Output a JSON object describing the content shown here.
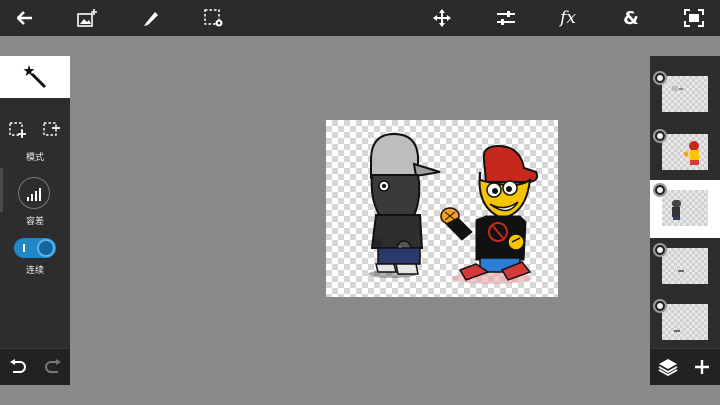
{
  "toolbar": {
    "icons": [
      "back-arrow-icon",
      "add-image-icon",
      "brush-icon",
      "selection-settings-icon",
      "move-icon",
      "adjustments-icon",
      "fx-icon",
      "ampersand-icon",
      "fit-screen-icon"
    ],
    "fx_label": "fx",
    "amp_label": "&"
  },
  "tools": {
    "active_tool": "magic-wand-icon",
    "mode_label": "模式",
    "tolerance_label": "容差",
    "contiguous_label": "连续",
    "contiguous_on": true
  },
  "layers": {
    "count": 5,
    "selected_index": 2
  },
  "colors": {
    "toolbar_bg": "#2b2b2b",
    "panel_bg": "#2d2d2d",
    "workspace_bg": "#8a8a8a",
    "toggle_accent": "#1e88c8"
  }
}
